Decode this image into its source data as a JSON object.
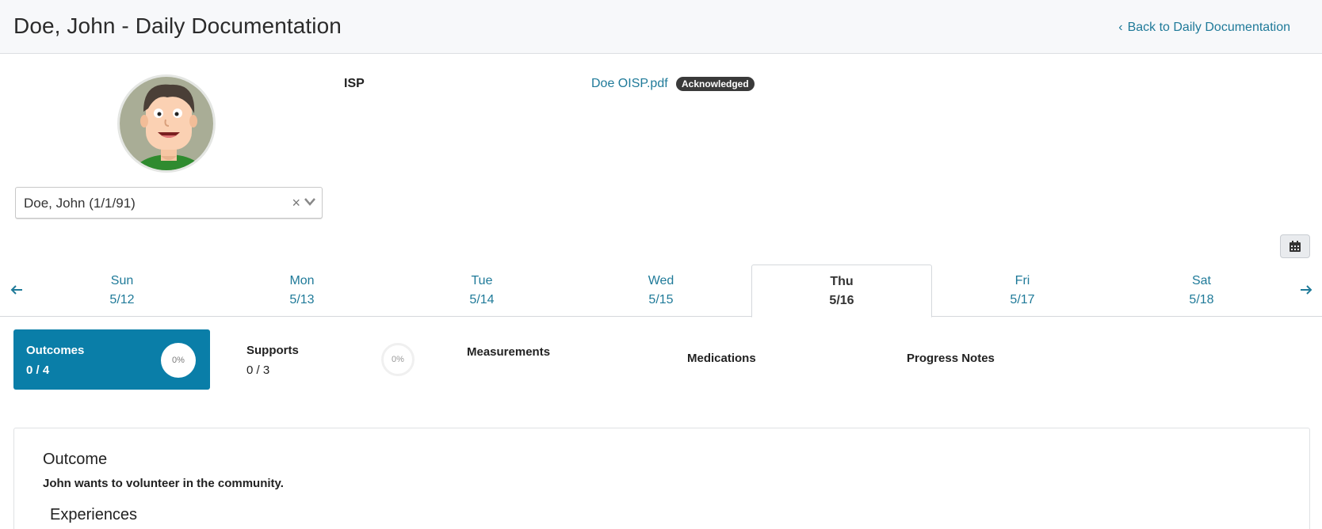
{
  "header": {
    "title": "Doe, John - Daily Documentation",
    "back_label": "Back to Daily Documentation"
  },
  "client": {
    "selected": "Doe, John (1/1/91)",
    "clear_glyph": "×"
  },
  "isp": {
    "label": "ISP",
    "file_name": "Doe OISP.pdf",
    "status_badge": "Acknowledged"
  },
  "week": {
    "days": [
      {
        "name": "Sun",
        "date": "5/12"
      },
      {
        "name": "Mon",
        "date": "5/13"
      },
      {
        "name": "Tue",
        "date": "5/14"
      },
      {
        "name": "Wed",
        "date": "5/15"
      },
      {
        "name": "Thu",
        "date": "5/16"
      },
      {
        "name": "Fri",
        "date": "5/17"
      },
      {
        "name": "Sat",
        "date": "5/18"
      }
    ],
    "active_day": "Thu"
  },
  "tabs": {
    "outcomes": {
      "title": "Outcomes",
      "count": "0 / 4",
      "percent": "0%"
    },
    "supports": {
      "title": "Supports",
      "count": "0 / 3",
      "percent": "0%"
    },
    "measurements": {
      "title": "Measurements"
    },
    "medications": {
      "title": "Medications"
    },
    "progress_notes": {
      "title": "Progress Notes"
    }
  },
  "outcome": {
    "heading": "Outcome",
    "description": "John wants to volunteer in the community.",
    "experiences_heading": "Experiences"
  },
  "colors": {
    "accent": "#0a7ea8",
    "link": "#1f7a99",
    "badge_bg": "#3a3a3a"
  },
  "icons": {
    "back": "chevron-left-icon",
    "calendar": "calendar-icon",
    "prev_week": "arrow-left-icon",
    "next_week": "arrow-right-icon",
    "dropdown": "chevron-down-icon",
    "clear": "close-icon"
  }
}
